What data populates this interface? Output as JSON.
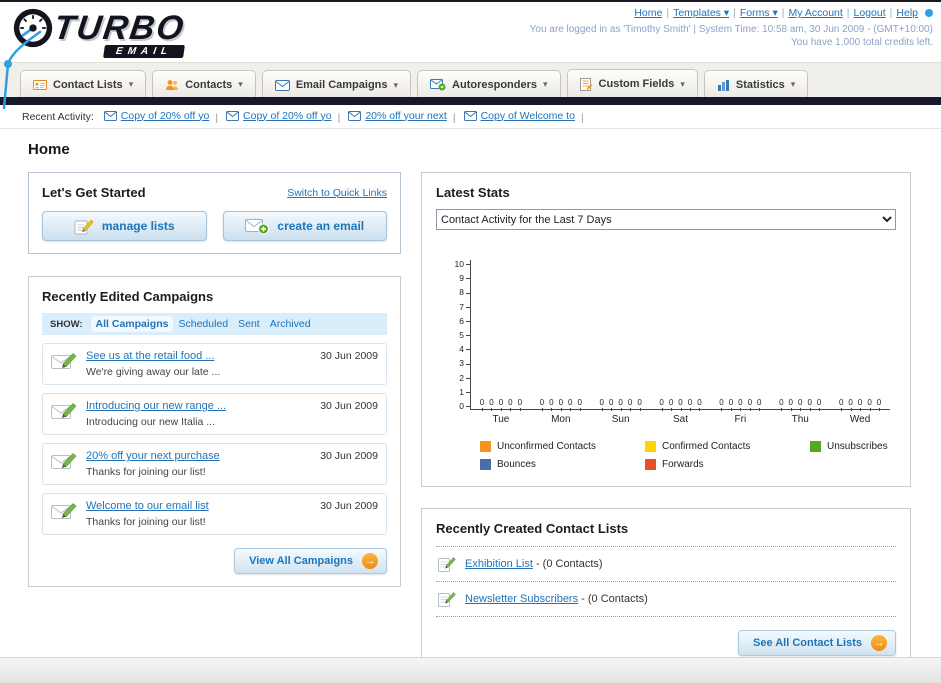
{
  "header": {
    "logo_main": "TURBO",
    "logo_sub": "EMAIL",
    "nav_links": [
      {
        "label": "Home",
        "dropdown": false
      },
      {
        "label": "Templates",
        "dropdown": true
      },
      {
        "label": "Forms",
        "dropdown": true
      },
      {
        "label": "My Account",
        "dropdown": false
      },
      {
        "label": "Logout",
        "dropdown": false
      },
      {
        "label": "Help",
        "dropdown": false
      }
    ],
    "login_info": "You are logged in as 'Timothy Smith' | System Time: 10:58 am, 30 Jun 2009 - (GMT+10:00)",
    "credits_info": "You have 1,000 total credits left."
  },
  "nav_tabs": [
    {
      "label": "Contact Lists",
      "icon": "contact-lists-icon"
    },
    {
      "label": "Contacts",
      "icon": "contacts-icon"
    },
    {
      "label": "Email Campaigns",
      "icon": "email-campaigns-icon"
    },
    {
      "label": "Autoresponders",
      "icon": "autoresponders-icon"
    },
    {
      "label": "Custom Fields",
      "icon": "custom-fields-icon"
    },
    {
      "label": "Statistics",
      "icon": "statistics-icon"
    }
  ],
  "recent_activity": {
    "label": "Recent Activity:",
    "items": [
      "Copy of 20% off yo",
      "Copy of 20% off yo",
      "20% off your next",
      "Copy of Welcome to"
    ]
  },
  "page_title": "Home",
  "get_started": {
    "title": "Let's Get Started",
    "switch_link": "Switch to Quick Links",
    "buttons": [
      {
        "label": "manage lists",
        "icon": "pencil-icon"
      },
      {
        "label": "create an email",
        "icon": "email-plus-icon"
      }
    ]
  },
  "campaigns": {
    "title": "Recently Edited Campaigns",
    "show_label": "SHOW:",
    "filters": [
      "All Campaigns",
      "Scheduled",
      "Sent",
      "Archived"
    ],
    "active_filter": "All Campaigns",
    "items": [
      {
        "title": "See us at the retail food ...",
        "subtitle": "We're giving away our late ...",
        "date": "30 Jun 2009"
      },
      {
        "title": "Introducing our new range ...",
        "subtitle": "Introducing our new Italia ...",
        "date": "30 Jun 2009"
      },
      {
        "title": "20% off your next purchase",
        "subtitle": "Thanks for joining our list!",
        "date": "30 Jun 2009"
      },
      {
        "title": "Welcome to our email list",
        "subtitle": "Thanks for joining our list!",
        "date": "30 Jun 2009"
      }
    ],
    "view_all_label": "View All Campaigns"
  },
  "stats": {
    "title": "Latest Stats",
    "dropdown_value": "Contact Activity for the Last 7 Days",
    "chart_data": {
      "type": "bar",
      "title": "Contact Activity for the Last 7 Days",
      "categories": [
        "Tue",
        "Mon",
        "Sun",
        "Sat",
        "Fri",
        "Thu",
        "Wed"
      ],
      "series": [
        {
          "name": "Unconfirmed Contacts",
          "color": "#f7941d",
          "values": [
            0,
            0,
            0,
            0,
            0,
            0,
            0
          ]
        },
        {
          "name": "Confirmed Contacts",
          "color": "#ffd400",
          "values": [
            0,
            0,
            0,
            0,
            0,
            0,
            0
          ]
        },
        {
          "name": "Unsubscribes",
          "color": "#56a721",
          "values": [
            0,
            0,
            0,
            0,
            0,
            0,
            0
          ]
        },
        {
          "name": "Bounces",
          "color": "#4a6da8",
          "values": [
            0,
            0,
            0,
            0,
            0,
            0,
            0
          ]
        },
        {
          "name": "Forwards",
          "color": "#e8502a",
          "values": [
            0,
            0,
            0,
            0,
            0,
            0,
            0
          ]
        }
      ],
      "ylim": [
        0,
        10
      ],
      "y_ticks": [
        0,
        1,
        2,
        3,
        4,
        5,
        6,
        7,
        8,
        9,
        10
      ],
      "grid": false,
      "legend_position": "bottom"
    }
  },
  "contact_lists": {
    "title": "Recently Created Contact Lists",
    "items": [
      {
        "name": "Exhibition List",
        "count_text": "- (0 Contacts)"
      },
      {
        "name": "Newsletter Subscribers",
        "count_text": "- (0 Contacts)"
      }
    ],
    "see_all_label": "See All Contact Lists"
  }
}
